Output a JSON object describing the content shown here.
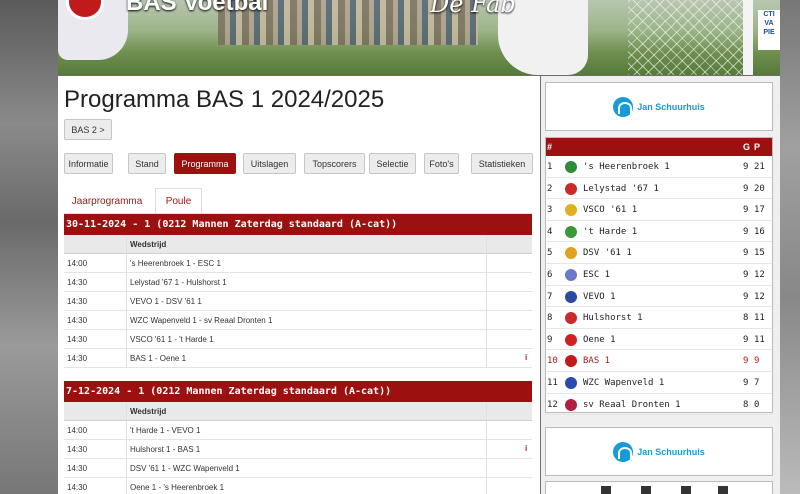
{
  "header": {
    "site_title": "BAS Voetbal",
    "slogan": "De Fab"
  },
  "page": {
    "title": "Programma BAS 1 2024/2025",
    "team_switch": "BAS 2 >"
  },
  "nav": [
    "Informatie",
    "Stand",
    "Programma",
    "Uitslagen",
    "Topscorers",
    "Selectie",
    "Foto's",
    "Statistieken"
  ],
  "subtabs": [
    "Jaarprogramma",
    "Poule"
  ],
  "col_header": "Wedstrijd",
  "sections": [
    {
      "title": "30-11-2024 - 1 (0212 Mannen Zaterdag standaard (A-cat))",
      "rows": [
        {
          "time": "14:00",
          "match": "'s Heerenbroek 1 - ESC 1",
          "info": ""
        },
        {
          "time": "14:30",
          "match": "Lelystad '67 1 - Hulshorst 1",
          "info": ""
        },
        {
          "time": "14:30",
          "match": "VEVO 1 - DSV '61 1",
          "info": ""
        },
        {
          "time": "14:30",
          "match": "WZC Wapenveld 1 - sv Reaal Dronten 1",
          "info": ""
        },
        {
          "time": "14:30",
          "match": "VSCO '61 1 - 't Harde 1",
          "info": ""
        },
        {
          "time": "14:30",
          "match": "BAS 1 - Oene 1",
          "info": "i"
        }
      ]
    },
    {
      "title": "7-12-2024 - 1 (0212 Mannen Zaterdag standaard (A-cat))",
      "rows": [
        {
          "time": "14:00",
          "match": "'t Harde 1 - VEVO 1",
          "info": ""
        },
        {
          "time": "14:30",
          "match": "Hulshorst 1 - BAS 1",
          "info": "i"
        },
        {
          "time": "14:30",
          "match": "DSV '61 1 - WZC Wapenveld 1",
          "info": ""
        },
        {
          "time": "14:30",
          "match": "Oene 1 - 's Heerenbroek 1",
          "info": ""
        }
      ]
    }
  ],
  "sponsor": {
    "name": "Jan Schuurhuis"
  },
  "standings": {
    "headers": {
      "pos": "#",
      "g": "G",
      "p": "P"
    },
    "rows": [
      {
        "pos": "1",
        "team": "'s Heerenbroek 1",
        "g": "9",
        "p": "21",
        "crest": "#2e8b3a"
      },
      {
        "pos": "2",
        "team": "Lelystad '67 1",
        "g": "9",
        "p": "20",
        "crest": "#c92a2a"
      },
      {
        "pos": "3",
        "team": "VSCO '61 1",
        "g": "9",
        "p": "17",
        "crest": "#e0b020"
      },
      {
        "pos": "4",
        "team": "'t Harde 1",
        "g": "9",
        "p": "16",
        "crest": "#3a9a3a"
      },
      {
        "pos": "5",
        "team": "DSV '61 1",
        "g": "9",
        "p": "15",
        "crest": "#e0a020"
      },
      {
        "pos": "6",
        "team": "ESC 1",
        "g": "9",
        "p": "12",
        "crest": "#6a7ac8"
      },
      {
        "pos": "7",
        "team": "VEVO 1",
        "g": "9",
        "p": "12",
        "crest": "#2a4aa0"
      },
      {
        "pos": "8",
        "team": "Hulshorst 1",
        "g": "8",
        "p": "11",
        "crest": "#c92a2a"
      },
      {
        "pos": "9",
        "team": "Oene 1",
        "g": "9",
        "p": "11",
        "crest": "#d02020"
      },
      {
        "pos": "10",
        "team": "BAS 1",
        "g": "9",
        "p": "9",
        "crest": "#c01a1a",
        "highlight": true
      },
      {
        "pos": "11",
        "team": "WZC Wapenveld 1",
        "g": "9",
        "p": "7",
        "crest": "#2a4ab0"
      },
      {
        "pos": "12",
        "team": "sv Reaal Dronten 1",
        "g": "8",
        "p": "0",
        "crest": "#b02040"
      }
    ]
  }
}
